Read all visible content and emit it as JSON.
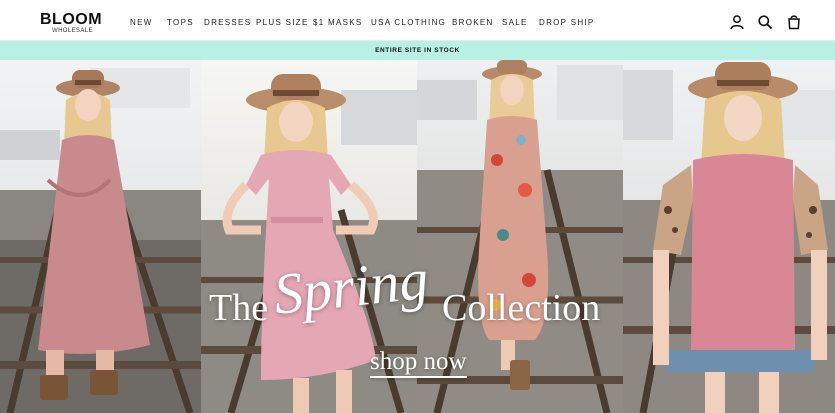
{
  "brand": {
    "name": "BLOOM",
    "subname": "WHOLESALE"
  },
  "nav": {
    "items": [
      {
        "label": "NEW"
      },
      {
        "label": "TOPS"
      },
      {
        "label": "DRESSES"
      },
      {
        "label": "PLUS SIZE"
      },
      {
        "label": "$1 MASKS"
      },
      {
        "label": "USA CLOTHING"
      },
      {
        "label": "BROKEN"
      },
      {
        "label": "SALE"
      },
      {
        "label": "DROP SHIP"
      }
    ]
  },
  "header_icons": [
    "account-icon",
    "search-icon",
    "cart-icon"
  ],
  "announcement": {
    "text": "ENTIRE SITE IN STOCK",
    "background": "#b9f0e4"
  },
  "hero": {
    "headline_the": "The",
    "headline_spring": "Spring",
    "headline_collection": "Collection",
    "cta": "shop now",
    "panels": [
      {
        "outfit": "mauve-pink ruffle midi dress",
        "color": "#c98a8e"
      },
      {
        "outfit": "pink floral wrap dress",
        "color": "#e6a7b5"
      },
      {
        "outfit": "floral print maxi dress",
        "color": "#d9a08f"
      },
      {
        "outfit": "pink top with leopard sleeves",
        "color": "#d98795"
      }
    ]
  }
}
